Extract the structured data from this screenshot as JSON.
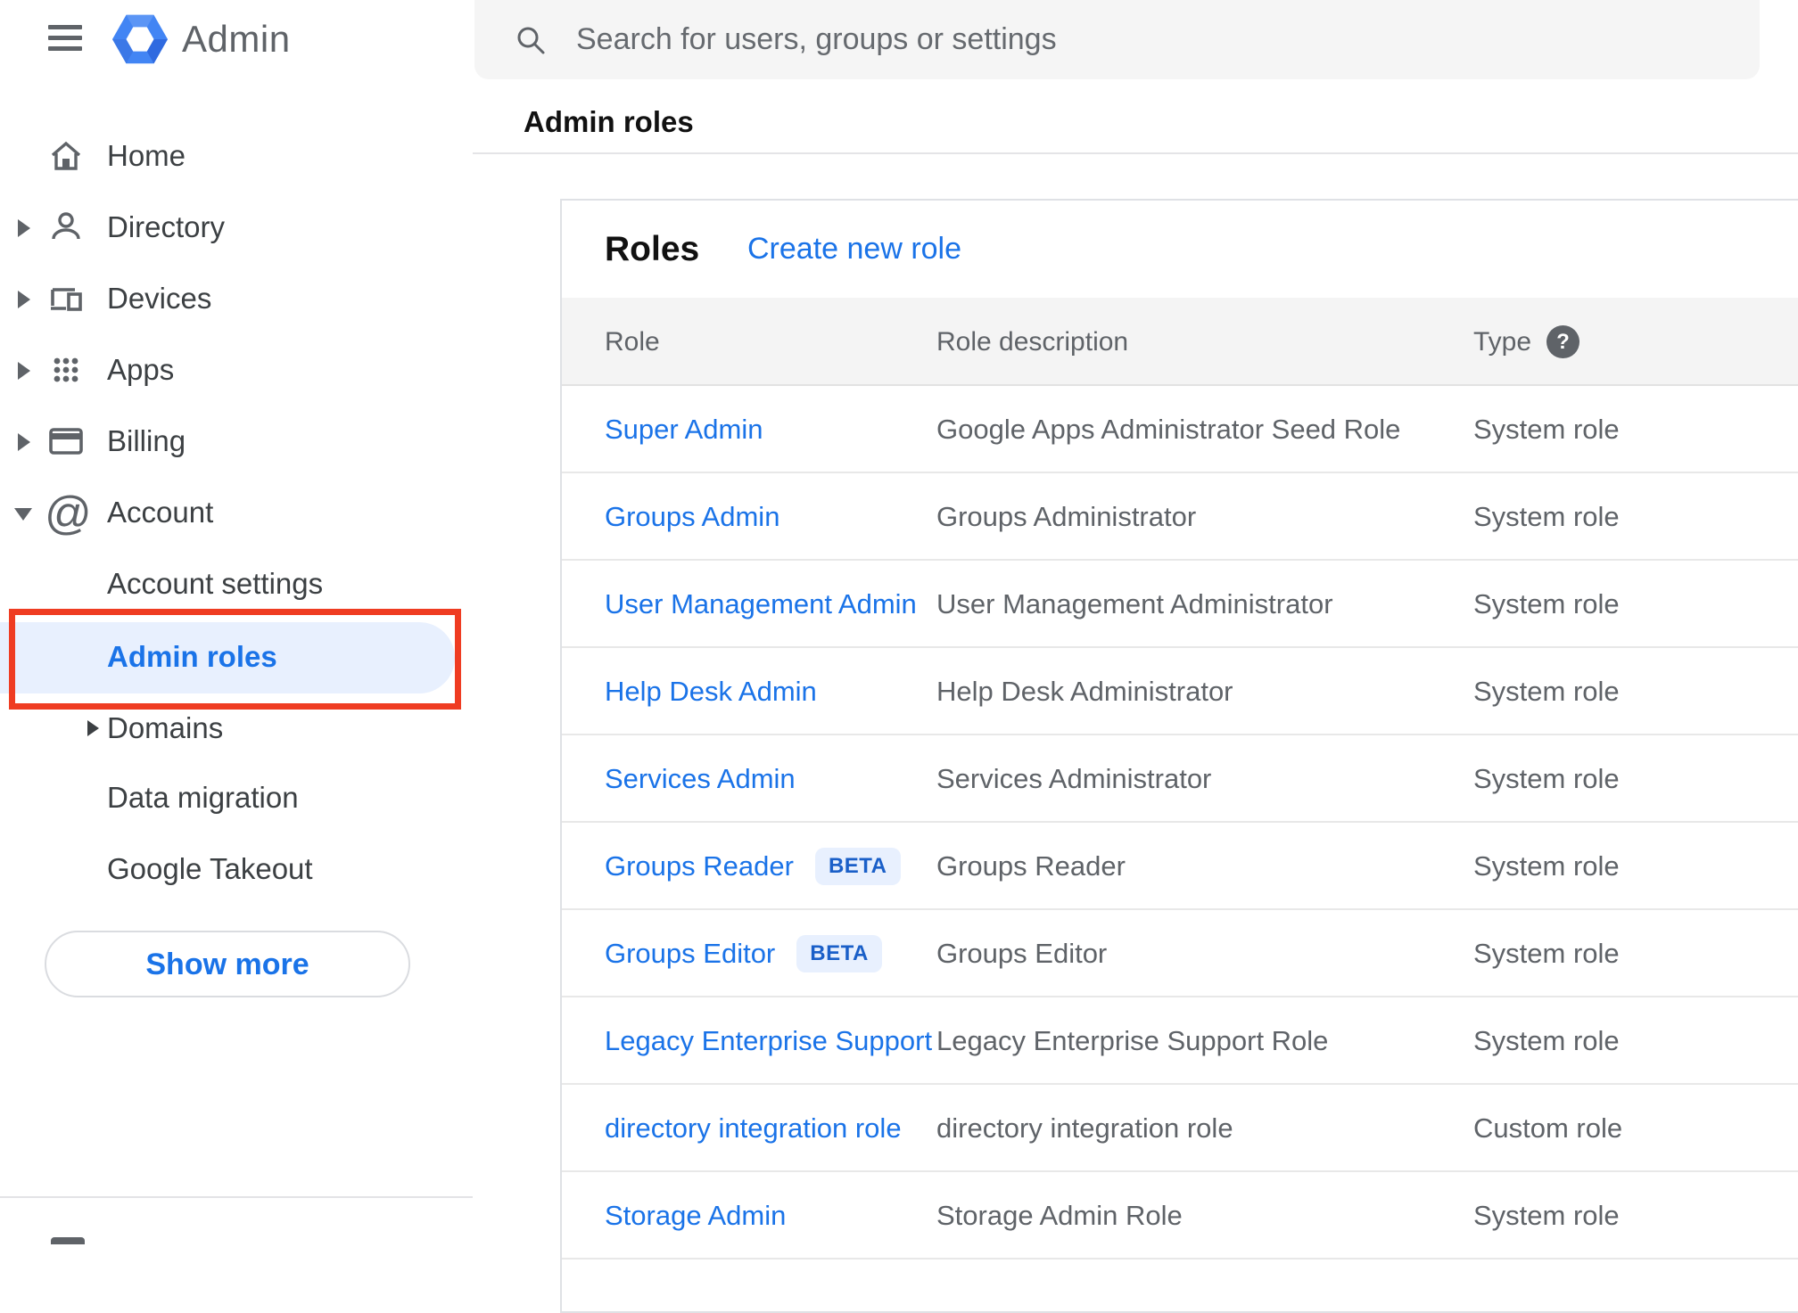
{
  "header": {
    "app_name": "Admin",
    "search_placeholder": "Search for users, groups or settings"
  },
  "icons": {
    "hamburger": "menu-icon",
    "logo": "admin-hexagon-logo",
    "search": "magnifier",
    "help": "?",
    "home": "house-outline",
    "directory": "person-outline",
    "devices": "laptop-and-phone",
    "apps": "nine-dot-grid",
    "billing": "credit-card",
    "account": "at-sign"
  },
  "sidebar": {
    "items": [
      {
        "label": "Home"
      },
      {
        "label": "Directory"
      },
      {
        "label": "Devices"
      },
      {
        "label": "Apps"
      },
      {
        "label": "Billing"
      },
      {
        "label": "Account"
      }
    ],
    "account_children": [
      {
        "label": "Account settings"
      },
      {
        "label": "Admin roles",
        "selected": true,
        "annotated": true
      },
      {
        "label": "Domains"
      },
      {
        "label": "Data migration"
      },
      {
        "label": "Google Takeout"
      }
    ],
    "show_more_label": "Show more",
    "at_glyph": "@"
  },
  "breadcrumb": "Admin roles",
  "roles_card": {
    "title": "Roles",
    "create_link": "Create new role",
    "columns": {
      "role": "Role",
      "description": "Role description",
      "type": "Type"
    },
    "beta_label": "BETA",
    "help_glyph": "?",
    "rows": [
      {
        "role": "Super Admin",
        "description": "Google Apps Administrator Seed Role",
        "type": "System role"
      },
      {
        "role": "Groups Admin",
        "description": "Groups Administrator",
        "type": "System role"
      },
      {
        "role": "User Management Admin",
        "description": "User Management Administrator",
        "type": "System role"
      },
      {
        "role": "Help Desk Admin",
        "description": "Help Desk Administrator",
        "type": "System role"
      },
      {
        "role": "Services Admin",
        "description": "Services Administrator",
        "type": "System role"
      },
      {
        "role": "Groups Reader",
        "beta": true,
        "description": "Groups Reader",
        "type": "System role"
      },
      {
        "role": "Groups Editor",
        "beta": true,
        "description": "Groups Editor",
        "type": "System role"
      },
      {
        "role": "Legacy Enterprise Support",
        "description": "Legacy Enterprise Support Role",
        "type": "System role"
      },
      {
        "role": "directory integration role",
        "description": "directory integration role",
        "type": "Custom role"
      },
      {
        "role": "Storage Admin",
        "description": "Storage Admin Role",
        "type": "System role"
      }
    ]
  },
  "colors": {
    "link_blue": "#1a73e8",
    "selected_item_bg": "#e8f0fe",
    "annotation_red": "#ef3c22",
    "beta_badge_bg": "#e8f0fe",
    "beta_badge_text": "#1a5fc8",
    "table_header_bg": "#f4f4f4",
    "searchbar_bg": "#f5f5f5",
    "icon_gray": "#5f6368"
  }
}
